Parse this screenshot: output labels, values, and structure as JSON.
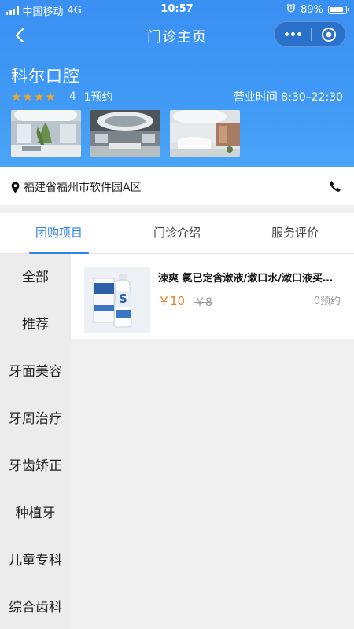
{
  "status_bar": {
    "carrier": "中国移动",
    "network": "4G",
    "time": "10:57",
    "battery": "89%"
  },
  "nav": {
    "title": "门诊主页"
  },
  "shop": {
    "name": "科尔口腔",
    "rating_stars": 4,
    "rating_score": "4",
    "bookings": "1预约",
    "hours": "营业时间 8:30–22:30"
  },
  "address": "福建省福州市软件园A区",
  "tabs": [
    {
      "label": "团购项目",
      "active": true
    },
    {
      "label": "门诊介绍",
      "active": false
    },
    {
      "label": "服务评价",
      "active": false
    }
  ],
  "categories": [
    "全部",
    "推荐",
    "牙面美容",
    "牙周治疗",
    "牙齿矫正",
    "种植牙",
    "儿童专科",
    "综合齿科"
  ],
  "products": [
    {
      "title": "涑爽 氯已定含漱液/漱口水/漱口液买一送一",
      "price": "￥10",
      "original_price": "￥8",
      "booked": "0预约"
    }
  ],
  "colors": {
    "header_blue": "#3f99f5",
    "accent_blue": "#2f80e8",
    "price_orange": "#f07c22",
    "star_gold": "#f5a623"
  },
  "icons": [
    "signal-icon",
    "alarm-icon",
    "battery-icon",
    "back-arrow-icon",
    "more-dots-icon",
    "close-target-icon",
    "location-pin-icon",
    "phone-icon",
    "star-icon"
  ]
}
